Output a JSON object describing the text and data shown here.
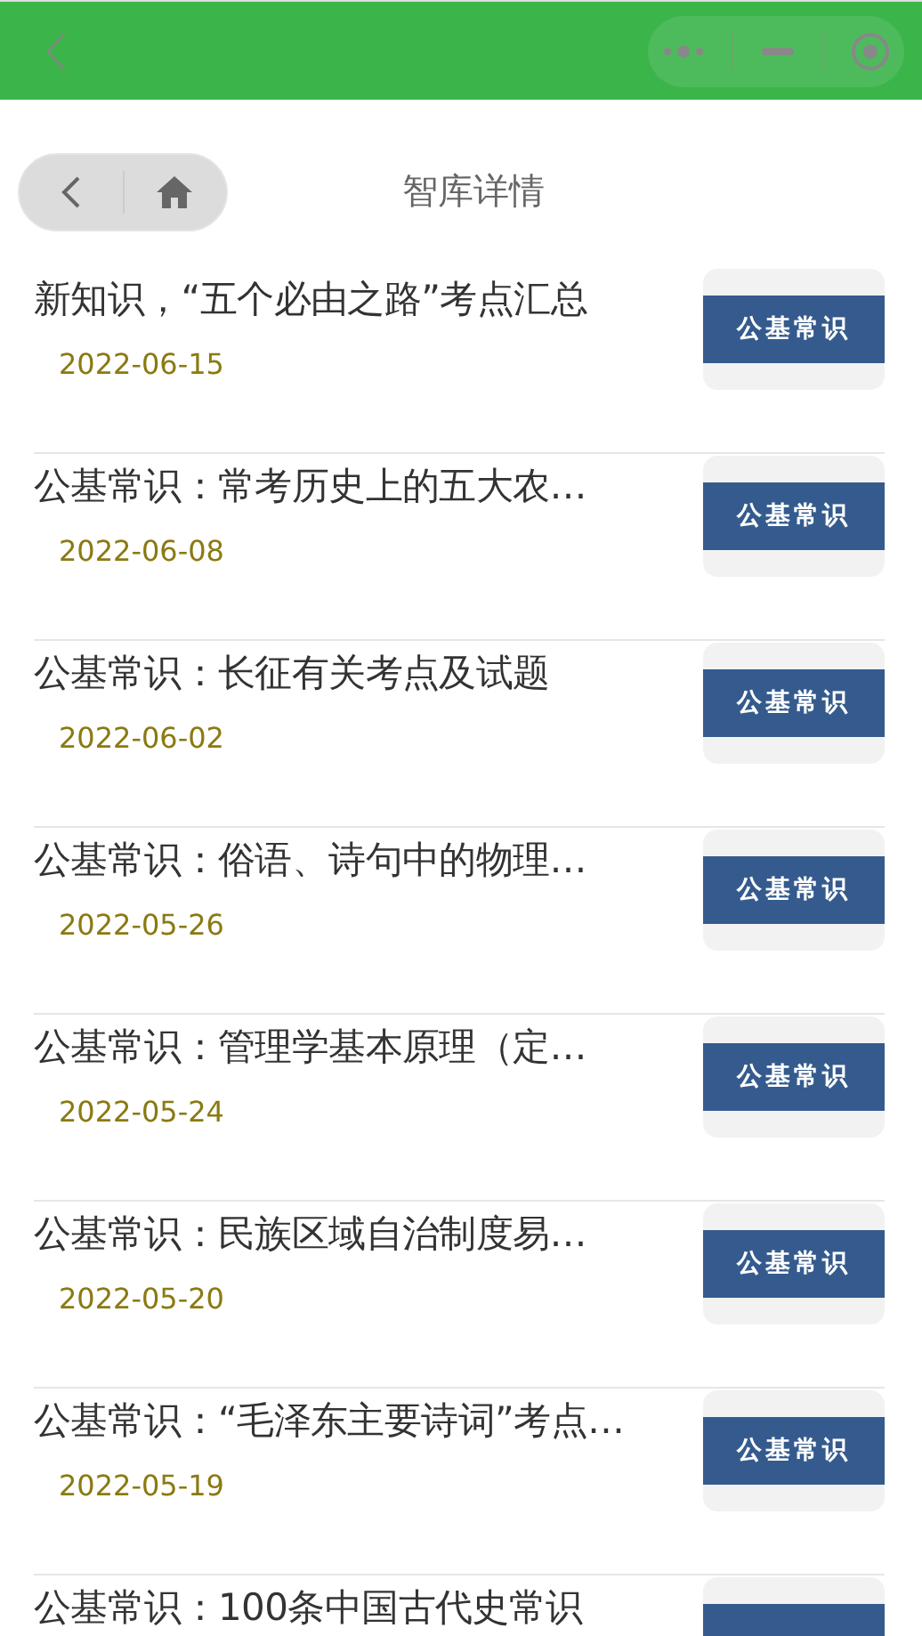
{
  "nav_bar": {
    "title": "智库详情"
  },
  "articles": [
    {
      "title": "新知识，“五个必由之路”考点汇总",
      "date": "2022-06-15",
      "thumb_label": "公基常识"
    },
    {
      "title": "公基常识：常考历史上的五大农…",
      "date": "2022-06-08",
      "thumb_label": "公基常识"
    },
    {
      "title": "公基常识：长征有关考点及试题",
      "date": "2022-06-02",
      "thumb_label": "公基常识"
    },
    {
      "title": "公基常识：俗语、诗句中的物理…",
      "date": "2022-05-26",
      "thumb_label": "公基常识"
    },
    {
      "title": "公基常识：管理学基本原理（定…",
      "date": "2022-05-24",
      "thumb_label": "公基常识"
    },
    {
      "title": "公基常识：民族区域自治制度易…",
      "date": "2022-05-20",
      "thumb_label": "公基常识"
    },
    {
      "title": "公基常识：“毛泽东主要诗词”考点…",
      "date": "2022-05-19",
      "thumb_label": "公基常识"
    },
    {
      "title": "公基常识：100条中国古代史常识"
    }
  ]
}
